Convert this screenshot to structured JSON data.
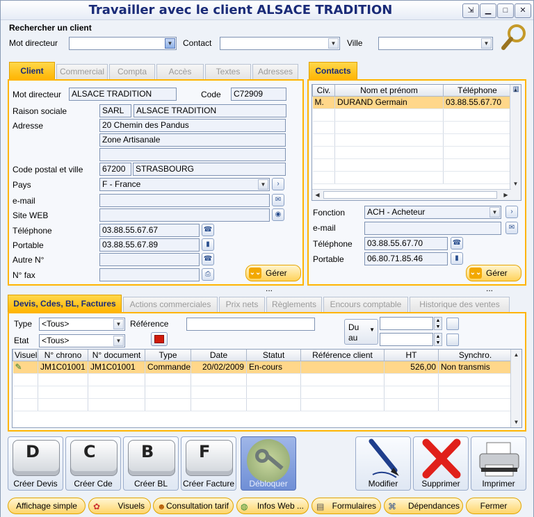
{
  "window": {
    "title": "Travailler avec le client ALSACE TRADITION"
  },
  "search": {
    "heading": "Rechercher un client",
    "mot_directeur_label": "Mot directeur",
    "contact_label": "Contact",
    "ville_label": "Ville",
    "mot_directeur_value": "",
    "contact_value": "",
    "ville_value": ""
  },
  "client_tabs": [
    "Client",
    "Commercial",
    "Compta",
    "Accès",
    "Textes",
    "Adresses"
  ],
  "client": {
    "mot_directeur_label": "Mot directeur",
    "mot_directeur": "ALSACE TRADITION",
    "code_label": "Code",
    "code": "C72909",
    "raison_sociale_label": "Raison sociale",
    "forme": "SARL",
    "raison_sociale": "ALSACE TRADITION",
    "adresse_label": "Adresse",
    "adresse1": "20 Chemin des Pandus",
    "adresse2": "Zone Artisanale",
    "adresse3": "",
    "cp_ville_label": "Code postal et ville",
    "code_postal": "67200",
    "ville": "STRASBOURG",
    "pays_label": "Pays",
    "pays": "F - France",
    "email_label": "e-mail",
    "email": "",
    "site_label": "Site WEB",
    "site": "",
    "tel_label": "Téléphone",
    "tel": "03.88.55.67.67",
    "portable_label": "Portable",
    "portable": "03.88.55.67.89",
    "autre_label": "Autre N°",
    "autre": "",
    "fax_label": "N° fax",
    "fax": "",
    "gerer": "Gérer ..."
  },
  "contacts": {
    "tab": "Contacts",
    "columns": [
      "Civ.",
      "Nom et prénom",
      "Téléphone"
    ],
    "rows": [
      [
        "M.",
        "DURAND Germain",
        "03.88.55.67.70"
      ]
    ],
    "fonction_label": "Fonction",
    "fonction": "ACH - Acheteur",
    "email_label": "e-mail",
    "email": "",
    "tel_label": "Téléphone",
    "tel": "03.88.55.67.70",
    "portable_label": "Portable",
    "portable": "06.80.71.85.46",
    "gerer": "Gérer ..."
  },
  "doc_tabs": [
    "Devis, Cdes, BL, Factures",
    "Actions commerciales",
    "Prix nets",
    "Règlements",
    "Encours comptable",
    "Historique des ventes"
  ],
  "filters": {
    "type_label": "Type",
    "type_value": "<Tous>",
    "etat_label": "Etat",
    "etat_value": "<Tous>",
    "reference_label": "Référence",
    "reference_value": "",
    "du_label": "Du",
    "au_label": "au",
    "du_value": "",
    "au_value": ""
  },
  "documents": {
    "columns": [
      "Visuel",
      "N° chrono",
      "N° document",
      "Type",
      "Date",
      "Statut",
      "Référence client",
      "HT",
      "Synchro."
    ],
    "rows": [
      [
        "",
        "JM1C01001",
        "JM1C01001",
        "Commande",
        "20/02/2009",
        "En-cours",
        "",
        "526,00",
        "Non transmis"
      ]
    ]
  },
  "actions": {
    "creer_devis": "Créer Devis",
    "creer_cde": "Créer Cde",
    "creer_bl": "Créer BL",
    "creer_facture": "Créer Facture",
    "debloquer": "Débloquer",
    "modifier": "Modifier",
    "supprimer": "Supprimer",
    "imprimer": "Imprimer",
    "key_d": "D",
    "key_c": "C",
    "key_b": "B",
    "key_f": "F"
  },
  "bottom": {
    "affichage": "Affichage simple",
    "visuels": "Visuels",
    "tarif": "Consultation tarif",
    "infos": "Infos Web ...",
    "formulaires": "Formulaires",
    "dependances": "Dépendances",
    "fermer": "Fermer"
  },
  "colors": {
    "accent": "#ffb400",
    "title": "#1a2b78",
    "selection": "#ffd78a"
  }
}
